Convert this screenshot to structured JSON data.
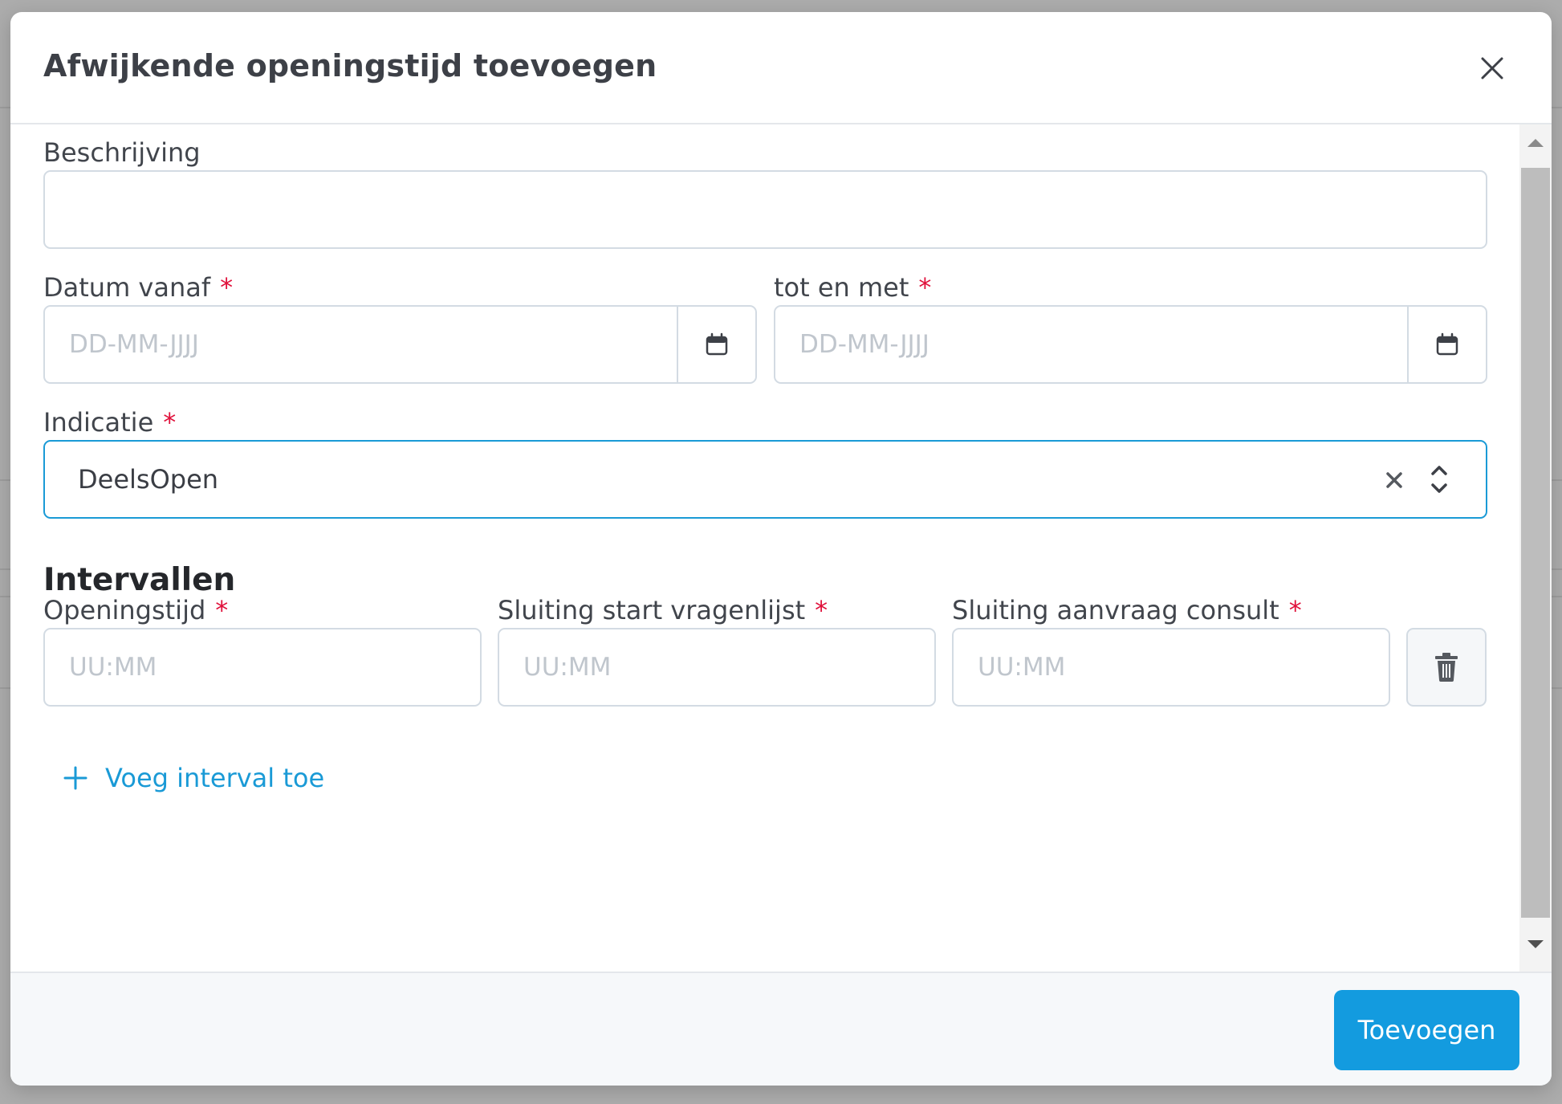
{
  "modal": {
    "title": "Afwijkende openingstijd toevoegen"
  },
  "form": {
    "description": {
      "label": "Beschrijving",
      "value": ""
    },
    "date_from": {
      "label": "Datum vanaf",
      "required_mark": "*",
      "placeholder": "DD-MM-JJJJ"
    },
    "date_to": {
      "label": "tot en met",
      "required_mark": "*",
      "placeholder": "DD-MM-JJJJ"
    },
    "indication": {
      "label": "Indicatie",
      "required_mark": "*",
      "selected": "DeelsOpen"
    }
  },
  "intervals": {
    "section_title": "Intervallen",
    "opening_time": {
      "label": "Openingstijd",
      "required_mark": "*",
      "placeholder": "UU:MM"
    },
    "closing_questionnaire": {
      "label": "Sluiting start vragenlijst",
      "required_mark": "*",
      "placeholder": "UU:MM"
    },
    "closing_consult": {
      "label": "Sluiting aanvraag consult",
      "required_mark": "*",
      "placeholder": "UU:MM"
    },
    "add_label": "Voeg interval toe"
  },
  "footer": {
    "submit_label": "Toevoegen"
  },
  "icons": {
    "close": "close-icon",
    "calendar": "calendar-icon",
    "clear": "clear-icon",
    "select_arrows": "chevron-up-down-icon",
    "trash": "trash-icon",
    "plus": "plus-icon"
  },
  "colors": {
    "accent": "#139bdf",
    "required": "#e0113b",
    "border": "#d3dbe3",
    "focus_border": "#1a9ad6"
  }
}
